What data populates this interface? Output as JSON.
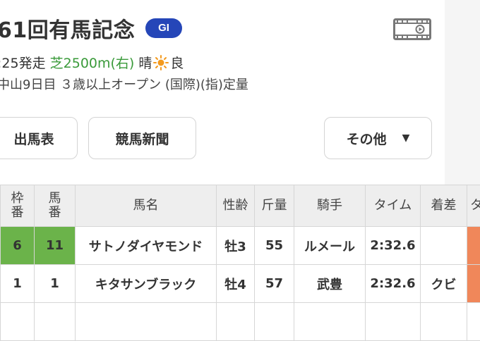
{
  "race": {
    "title": "61回有馬記念",
    "grade": "GI",
    "start_time": ":25発走",
    "course": "芝2500m(右)",
    "weather": "晴",
    "condition": "良",
    "meta": "中山9日目 ３歳以上オープン (国際)(指)定量"
  },
  "nav": {
    "entries_label": "出馬表",
    "newspaper_label": "競馬新聞",
    "other_label": "その他",
    "other_caret": "▼"
  },
  "table": {
    "headers": [
      "枠\n番",
      "馬\n番",
      "馬名",
      "性齢",
      "斤量",
      "騎手",
      "タイム",
      "着差",
      "タ"
    ],
    "rows": [
      {
        "frame": "6",
        "number": "11",
        "horse": "サトノダイヤモンド",
        "sex_age": "牡3",
        "weight": "55",
        "jockey": "ルメール",
        "time": "2:32.6",
        "margin": ""
      },
      {
        "frame": "1",
        "number": "1",
        "horse": "キタサンブラック",
        "sex_age": "牡4",
        "weight": "57",
        "jockey": "武豊",
        "time": "2:32.6",
        "margin": "クビ"
      }
    ]
  },
  "icons": {
    "video": "video-icon",
    "weather": "sun-icon"
  },
  "colors": {
    "grade_badge": "#2546b8",
    "horse_link": "#2546b8",
    "course_text": "#3a9a3a",
    "frame6": "#6bb34a",
    "accent_column": "#f0875a"
  }
}
